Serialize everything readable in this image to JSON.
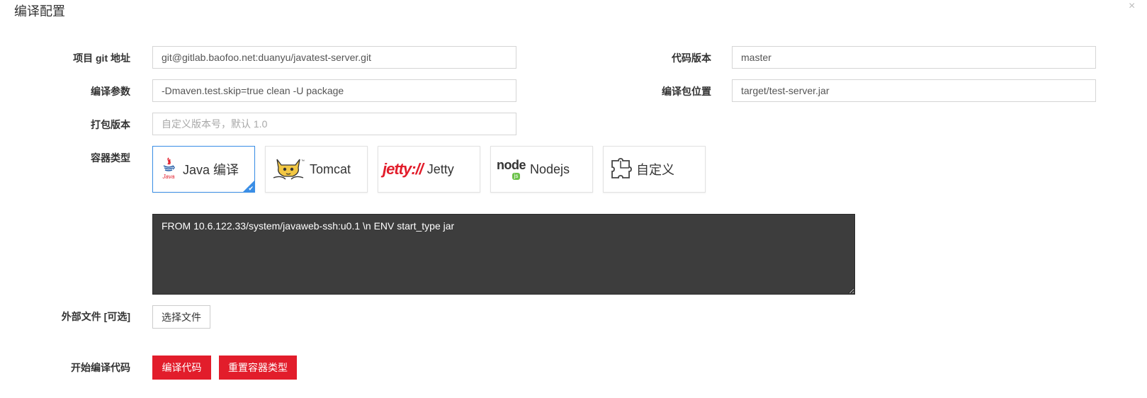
{
  "dialog": {
    "title": "编译配置",
    "close_glyph": "×"
  },
  "form": {
    "git_url": {
      "label": "项目 git 地址",
      "value": "git@gitlab.baofoo.net:duanyu/javatest-server.git"
    },
    "code_version": {
      "label": "代码版本",
      "value": "master"
    },
    "build_args": {
      "label": "编译参数",
      "value": "-Dmaven.test.skip=true clean -U package"
    },
    "package_path": {
      "label": "编译包位置",
      "value": "target/test-server.jar"
    },
    "package_version": {
      "label": "打包版本",
      "value": "",
      "placeholder": "自定义版本号，默认 1.0"
    },
    "container_type": {
      "label": "容器类型",
      "options": [
        {
          "name": "Java 编译",
          "icon": "java-icon",
          "selected": true
        },
        {
          "name": "Tomcat",
          "icon": "tomcat-icon",
          "selected": false
        },
        {
          "name": "Jetty",
          "icon": "jetty-icon",
          "logo_text": "jetty://",
          "selected": false
        },
        {
          "name": "Nodejs",
          "icon": "nodejs-icon",
          "logo_text": "node",
          "logo_sub": "js",
          "selected": false
        },
        {
          "name": "自定义",
          "icon": "puzzle-icon",
          "selected": false
        }
      ]
    },
    "dockerfile": {
      "value": "FROM 10.6.122.33/system/javaweb-ssh:u0.1 \\n ENV start_type jar"
    },
    "external_files": {
      "label": "外部文件 [可选]",
      "button": "选择文件"
    },
    "start_build": {
      "label": "开始编译代码",
      "build_button": "编译代码",
      "reset_button": "重置容器类型"
    }
  },
  "colors": {
    "accent": "#3a8ee6",
    "danger": "#e21d2b",
    "editor_bg": "#3d3d3d"
  }
}
